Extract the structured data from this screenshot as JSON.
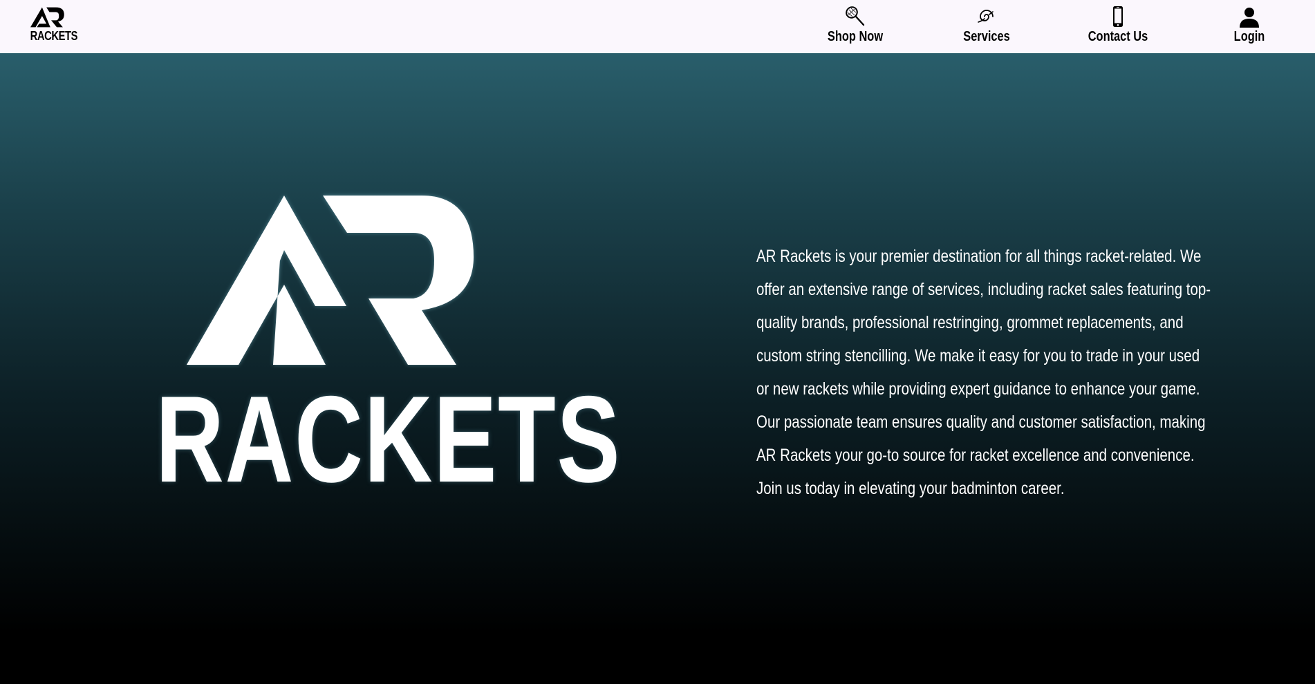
{
  "navbar": {
    "logo_text": "RACKETS",
    "items": [
      {
        "label": "Shop Now",
        "icon": "racket-icon"
      },
      {
        "label": "Services",
        "icon": "services-swirl-icon"
      },
      {
        "label": "Contact Us",
        "icon": "phone-icon"
      },
      {
        "label": "Login",
        "icon": "user-icon"
      }
    ]
  },
  "hero": {
    "wordmark": "RACKETS",
    "description": "AR Rackets is your premier destination for all things racket-related. We offer an extensive range of services, including racket sales featuring top-quality brands, professional restringing, grommet replacements, and custom string stencilling. We make it easy for you to trade in your used or new rackets while providing expert guidance to enhance your game. Our passionate team ensures quality and customer satisfaction, making AR Rackets your go-to source for racket excellence and convenience. Join us today in elevating your badminton career."
  },
  "colors": {
    "navbar_bg": "#fbf7fd",
    "hero_gradient_top": "#295e6b",
    "hero_gradient_bottom": "#000000",
    "text_light": "#ffffff",
    "text_dark": "#000000"
  }
}
